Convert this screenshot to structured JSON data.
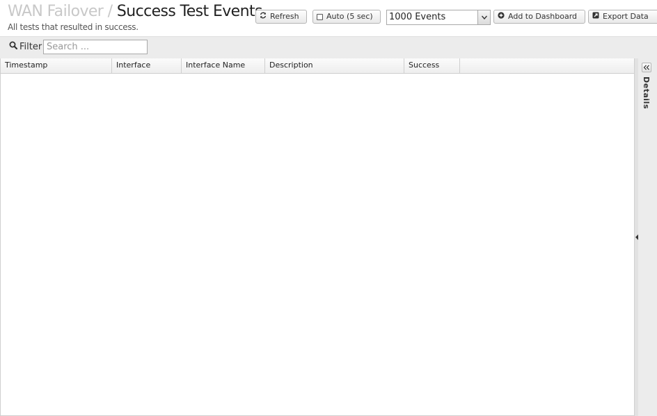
{
  "header": {
    "breadcrumb": "WAN Failover",
    "separator": "/",
    "title": "Success Test Events",
    "subtitle": "All tests that resulted in success."
  },
  "toolbar": {
    "refresh_label": "Refresh",
    "refresh_icon": "refresh-icon",
    "auto_label": "Auto (5 sec)",
    "auto_checked": false,
    "events_select_value": "1000 Events",
    "add_dashboard_label": "Add to Dashboard",
    "add_dashboard_icon": "plus-circle-icon",
    "export_label": "Export Data",
    "export_icon": "external-link-icon"
  },
  "filter": {
    "label": "Filter",
    "icon": "search-icon",
    "placeholder": "Search ..."
  },
  "grid": {
    "columns": [
      "Timestamp",
      "Interface",
      "Interface Name",
      "Description",
      "Success"
    ],
    "rows": []
  },
  "details": {
    "label": "Details"
  }
}
